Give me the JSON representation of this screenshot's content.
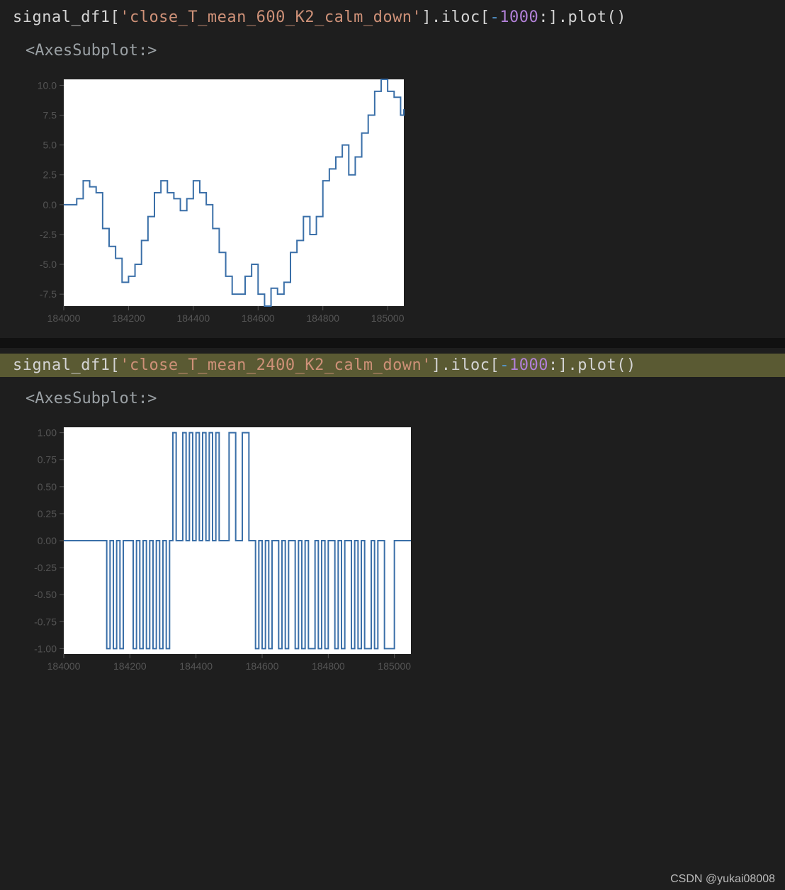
{
  "cells": [
    {
      "code_tokens": [
        {
          "t": "signal_df1",
          "c": "id"
        },
        {
          "t": "[",
          "c": "punc"
        },
        {
          "t": "'close_T_mean_600_K2_calm_down'",
          "c": "str"
        },
        {
          "t": "].",
          "c": "punc"
        },
        {
          "t": "iloc",
          "c": "id"
        },
        {
          "t": "[",
          "c": "punc"
        },
        {
          "t": "-",
          "c": "op"
        },
        {
          "t": "1000",
          "c": "num"
        },
        {
          "t": ":].",
          "c": "punc"
        },
        {
          "t": "plot",
          "c": "id"
        },
        {
          "t": "()",
          "c": "punc"
        }
      ],
      "highlight": false,
      "output_text": "<AxesSubplot:>"
    },
    {
      "code_tokens": [
        {
          "t": "signal_df1",
          "c": "id"
        },
        {
          "t": "[",
          "c": "punc"
        },
        {
          "t": "'close_T_mean_2400_K2_calm_down'",
          "c": "str"
        },
        {
          "t": "].",
          "c": "punc"
        },
        {
          "t": "iloc",
          "c": "id"
        },
        {
          "t": "[",
          "c": "punc"
        },
        {
          "t": "-",
          "c": "op"
        },
        {
          "t": "1000",
          "c": "num"
        },
        {
          "t": ":].",
          "c": "punc"
        },
        {
          "t": "plot",
          "c": "id"
        },
        {
          "t": "()",
          "c": "punc"
        }
      ],
      "highlight": true,
      "output_text": "<AxesSubplot:>"
    }
  ],
  "chart_data": [
    {
      "type": "line",
      "title": "",
      "xlabel": "",
      "ylabel": "",
      "xlim": [
        184000,
        185050
      ],
      "ylim": [
        -8.5,
        10.5
      ],
      "xticks": [
        184000,
        184200,
        184400,
        184600,
        184800,
        185000
      ],
      "yticks": [
        -7.5,
        -5.0,
        -2.5,
        0.0,
        2.5,
        5.0,
        7.5,
        10.0
      ],
      "series": [
        {
          "name": "close_T_mean_600_K2_calm_down",
          "x": [
            184000,
            184020,
            184040,
            184060,
            184080,
            184100,
            184120,
            184140,
            184160,
            184180,
            184200,
            184220,
            184240,
            184260,
            184280,
            184300,
            184320,
            184340,
            184360,
            184380,
            184400,
            184420,
            184440,
            184460,
            184480,
            184500,
            184520,
            184540,
            184560,
            184580,
            184600,
            184620,
            184640,
            184660,
            184680,
            184700,
            184720,
            184740,
            184760,
            184780,
            184800,
            184820,
            184840,
            184860,
            184880,
            184900,
            184920,
            184940,
            184960,
            184980,
            185000,
            185020,
            185040,
            185050
          ],
          "y": [
            0,
            0,
            0.5,
            2,
            1.5,
            1,
            -2,
            -3.5,
            -4.5,
            -6.5,
            -6,
            -5,
            -3,
            -1,
            1,
            2,
            1,
            0.5,
            -0.5,
            0.5,
            2,
            1,
            0,
            -2,
            -4,
            -6,
            -7.5,
            -7.5,
            -6,
            -5,
            -7.5,
            -8.5,
            -7,
            -7.5,
            -6.5,
            -4,
            -3,
            -1,
            -2.5,
            -1,
            2,
            3,
            4,
            5,
            2.5,
            4,
            6,
            7.5,
            9.5,
            10.5,
            9.5,
            9,
            7.5,
            8
          ]
        }
      ]
    },
    {
      "type": "line",
      "title": "",
      "xlabel": "",
      "ylabel": "",
      "xlim": [
        184000,
        185050
      ],
      "ylim": [
        -1.05,
        1.05
      ],
      "xticks": [
        184000,
        184200,
        184400,
        184600,
        184800,
        185000
      ],
      "yticks": [
        -1.0,
        -0.75,
        -0.5,
        -0.25,
        0.0,
        0.25,
        0.5,
        0.75,
        1.0
      ],
      "series": [
        {
          "name": "close_T_mean_2400_K2_calm_down",
          "x": [
            184000,
            184030,
            184060,
            184090,
            184120,
            184130,
            184140,
            184150,
            184160,
            184170,
            184180,
            184200,
            184210,
            184220,
            184230,
            184240,
            184250,
            184260,
            184270,
            184280,
            184290,
            184300,
            184310,
            184320,
            184330,
            184340,
            184360,
            184370,
            184380,
            184390,
            184400,
            184410,
            184420,
            184430,
            184440,
            184450,
            184460,
            184470,
            184500,
            184520,
            184540,
            184560,
            184570,
            184580,
            184590,
            184600,
            184610,
            184620,
            184630,
            184650,
            184660,
            184670,
            184680,
            184700,
            184710,
            184720,
            184730,
            184740,
            184760,
            184770,
            184780,
            184790,
            184800,
            184820,
            184830,
            184840,
            184850,
            184870,
            184880,
            184890,
            184900,
            184910,
            184930,
            184940,
            184950,
            184970,
            185000,
            185020,
            185050
          ],
          "y": [
            0,
            0,
            0,
            0,
            0,
            -1,
            0,
            -1,
            0,
            -1,
            0,
            0,
            -1,
            0,
            -1,
            0,
            -1,
            0,
            -1,
            0,
            -1,
            0,
            -1,
            0,
            1,
            0,
            1,
            0,
            1,
            0,
            1,
            0,
            1,
            0,
            1,
            0,
            1,
            0,
            1,
            0,
            1,
            0,
            0,
            -1,
            0,
            -1,
            0,
            -1,
            0,
            -1,
            0,
            -1,
            0,
            -1,
            0,
            -1,
            0,
            -1,
            0,
            -1,
            0,
            -1,
            0,
            -1,
            0,
            -1,
            0,
            -1,
            0,
            -1,
            0,
            -1,
            0,
            -1,
            0,
            -1,
            0,
            0,
            0
          ]
        }
      ]
    }
  ],
  "attribution": "CSDN @yukai08008"
}
